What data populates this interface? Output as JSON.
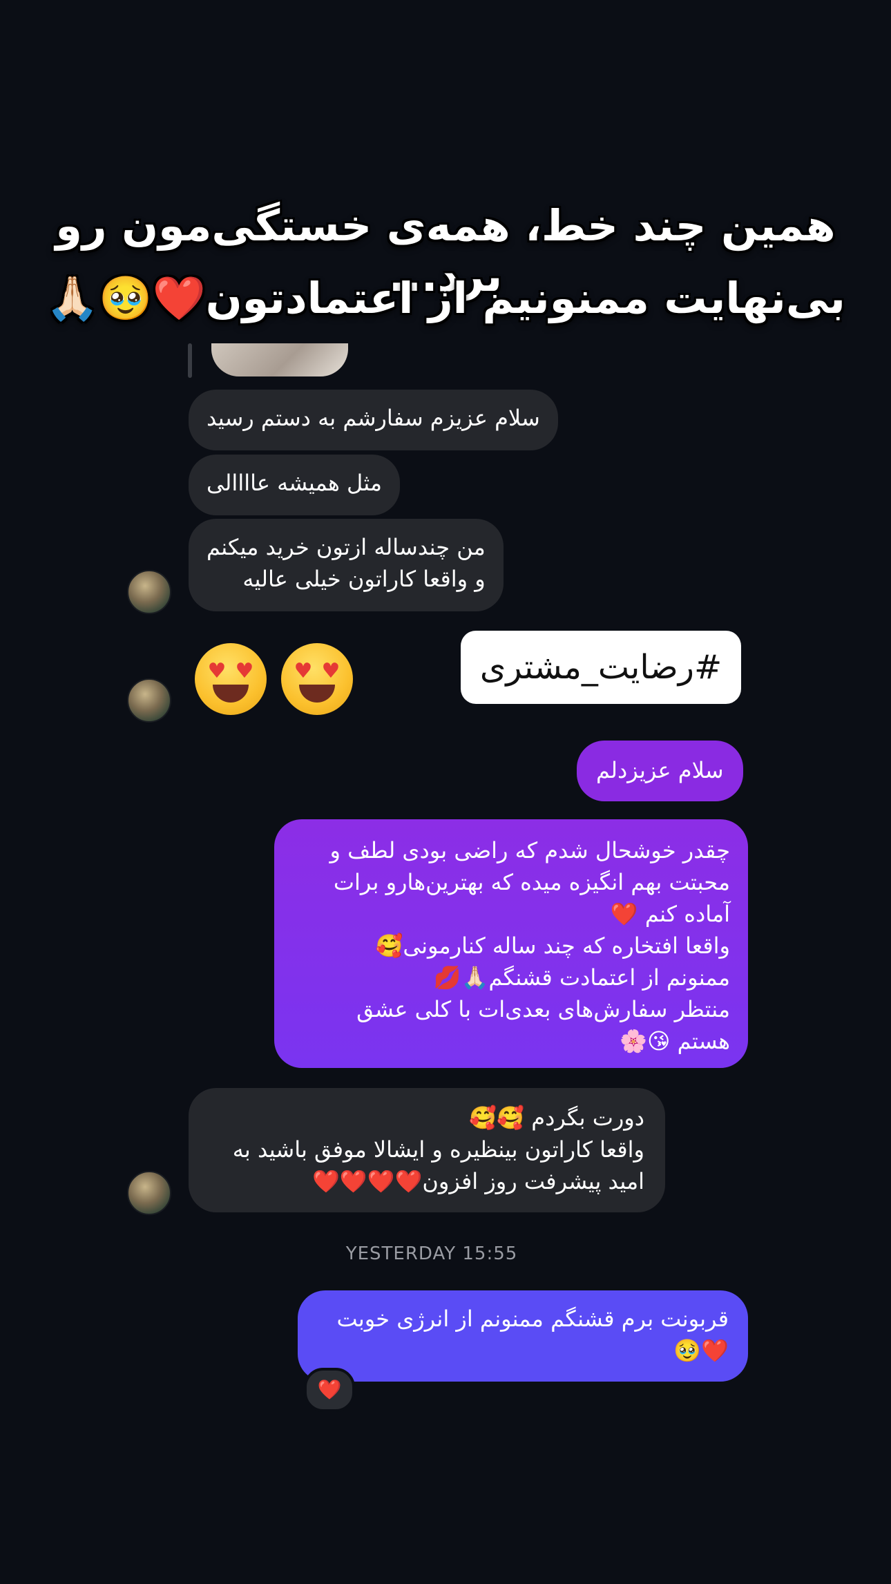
{
  "overlay": {
    "line1": "همین چند خط، همه‌ی خستگی‌مون رو برد...",
    "line2": "بی‌نهایت ممنونیم از اعتمادتون❤️🥹🙏🏻"
  },
  "messages": {
    "in1": "سلام عزیزم سفارشم به دستم رسید",
    "in2": "مثل همیشه عاااالی",
    "in3": "من چندساله ازتون خرید میکنم\nو واقعا کاراتون خیلی عالیه",
    "sticker": "#رضایت_مشتری",
    "out1": "سلام عزیزدلم",
    "out2": "چقدر خوشحال شدم که راضی بودی لطف و\nمحبتت بهم انگیزه میده که بهترین‌هارو برات\nآماده کنم ❤️\nواقعا افتخاره که چند ساله کنارمونی🥰\nممنونم از اعتمادت قشنگم🙏🏻💋\nمنتظر سفارش‌های بعدی‌ات با کلی عشق\nهستم 😘🌸",
    "in4": "دورت بگردم 🥰🥰\nواقعا کاراتون بینظیره و ایشالا موفق باشید به\nامید پیشرفت روز افزون❤️❤️❤️❤️",
    "timestamp": "YESTERDAY 15:55",
    "out3": "قربونت برم قشنگم ممنونم از انرژی خوبت\n❤️🥹",
    "reaction": "❤️"
  },
  "colors": {
    "background": "#0b0e15",
    "incoming_bubble": "#25272c",
    "outgoing_purple": "#8a2be2",
    "outgoing_indigo": "#5a4cf5"
  }
}
